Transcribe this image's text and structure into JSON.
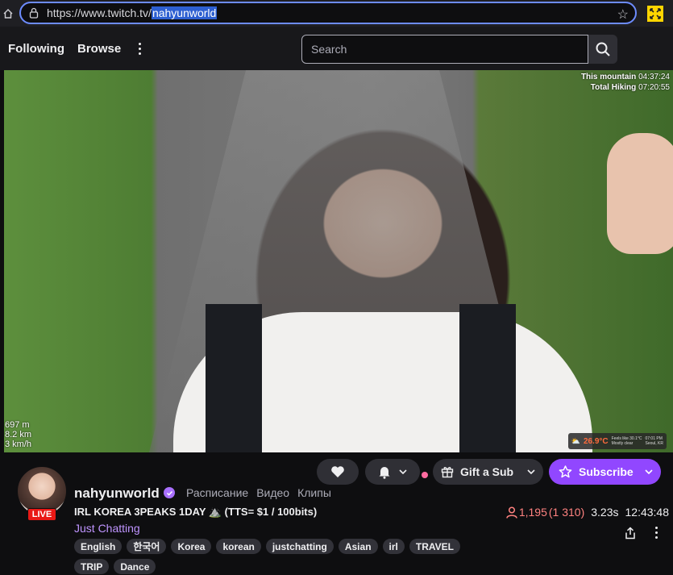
{
  "browser": {
    "url_prefix": "https://www.twitch.tv/",
    "url_selected": "nahyunworld"
  },
  "topnav": {
    "following": "Following",
    "browse": "Browse",
    "search_placeholder": "Search"
  },
  "video_overlay": {
    "this_mountain_label": "This mountain",
    "this_mountain_value": "04:37:24",
    "total_hiking_label": "Total Hiking",
    "total_hiking_value": "07:20:55",
    "altitude": "697 m",
    "distance": "8.2 km",
    "speed": "3 km/h",
    "weather_temp": "26.9°C",
    "weather_line1": "Feels like 30.1°C",
    "weather_line2": "Mostly clear",
    "weather_time": "07:01 PM",
    "weather_city": "Seoul, KR"
  },
  "channel": {
    "name": "nahyunworld",
    "live_badge": "LIVE",
    "links": [
      "Расписание",
      "Видео",
      "Клипы"
    ],
    "title": "IRL KOREA 3PEAKS 1DAY ⛰️ (TTS= $1 / 100bits)",
    "category": "Just Chatting",
    "tags": [
      "English",
      "한국어",
      "Korea",
      "korean",
      "justchatting",
      "Asian",
      "irl",
      "TRAVEL",
      "TRIP",
      "Dance"
    ]
  },
  "actions": {
    "gift": "Gift a Sub",
    "subscribe": "Subscribe"
  },
  "stats": {
    "viewers": "1,195",
    "viewers_total": "(1 310)",
    "latency": "3.23s",
    "uptime": "12:43:48"
  },
  "colors": {
    "accent": "#9147ff",
    "live": "#e91916",
    "category": "#bf94ff",
    "viewers": "#ff8280"
  }
}
